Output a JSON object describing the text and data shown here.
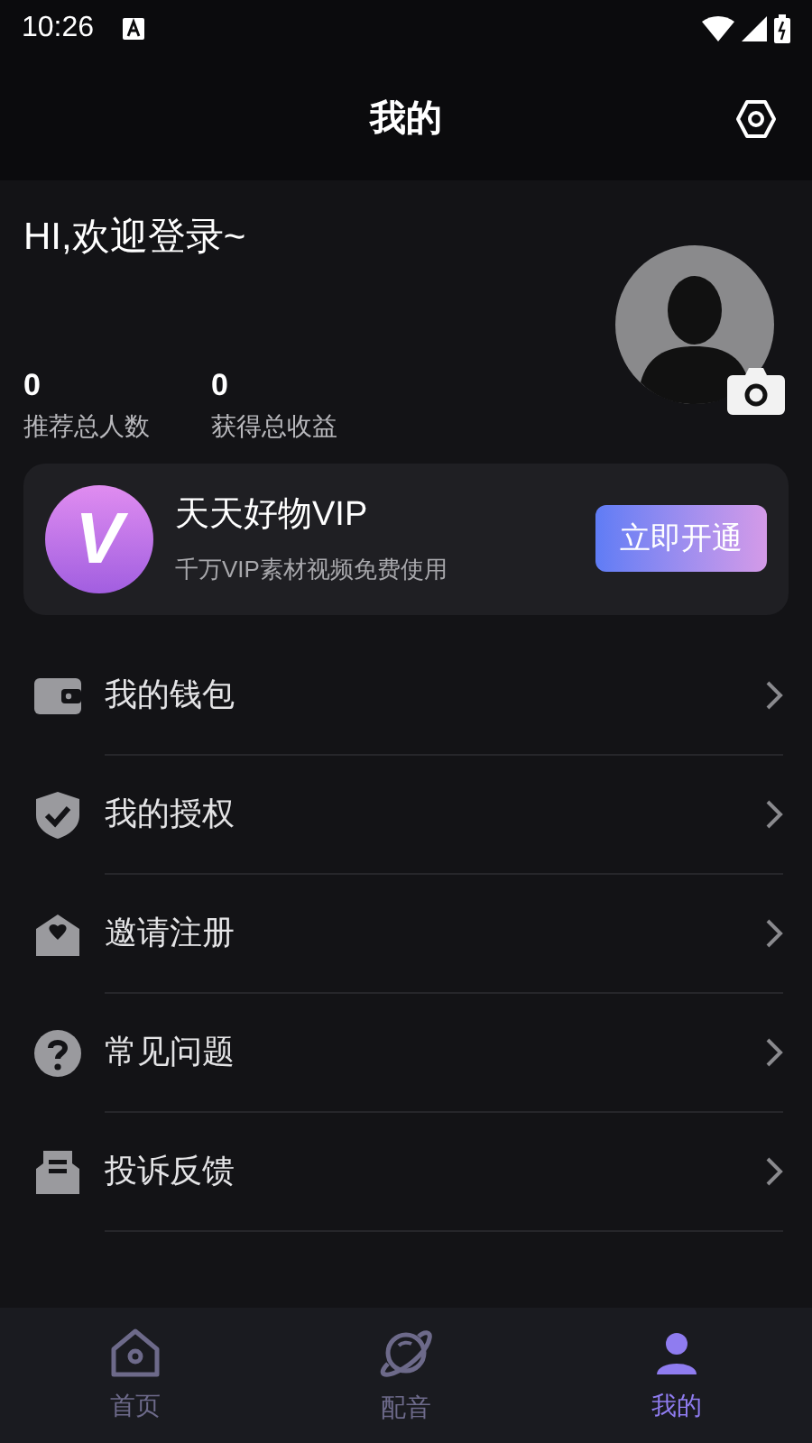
{
  "status_bar": {
    "time": "10:26"
  },
  "header": {
    "title": "我的"
  },
  "profile": {
    "greeting": "HI,欢迎登录~",
    "stats": [
      {
        "value": "0",
        "label": "推荐总人数"
      },
      {
        "value": "0",
        "label": "获得总收益"
      }
    ]
  },
  "vip_card": {
    "logo": "V",
    "title": "天天好物VIP",
    "subtitle": "千万VIP素材视频免费使用",
    "button": "立即开通"
  },
  "menu": [
    {
      "kind": "wallet",
      "label": "我的钱包"
    },
    {
      "kind": "shield",
      "label": "我的授权"
    },
    {
      "kind": "mail",
      "label": "邀请注册"
    },
    {
      "kind": "question",
      "label": "常见问题"
    },
    {
      "kind": "feedback",
      "label": "投诉反馈"
    }
  ],
  "tab_bar": [
    {
      "kind": "home",
      "label": "首页",
      "selected": false
    },
    {
      "kind": "planet",
      "label": "配音",
      "selected": false
    },
    {
      "kind": "user",
      "label": "我的",
      "selected": true
    }
  ]
}
